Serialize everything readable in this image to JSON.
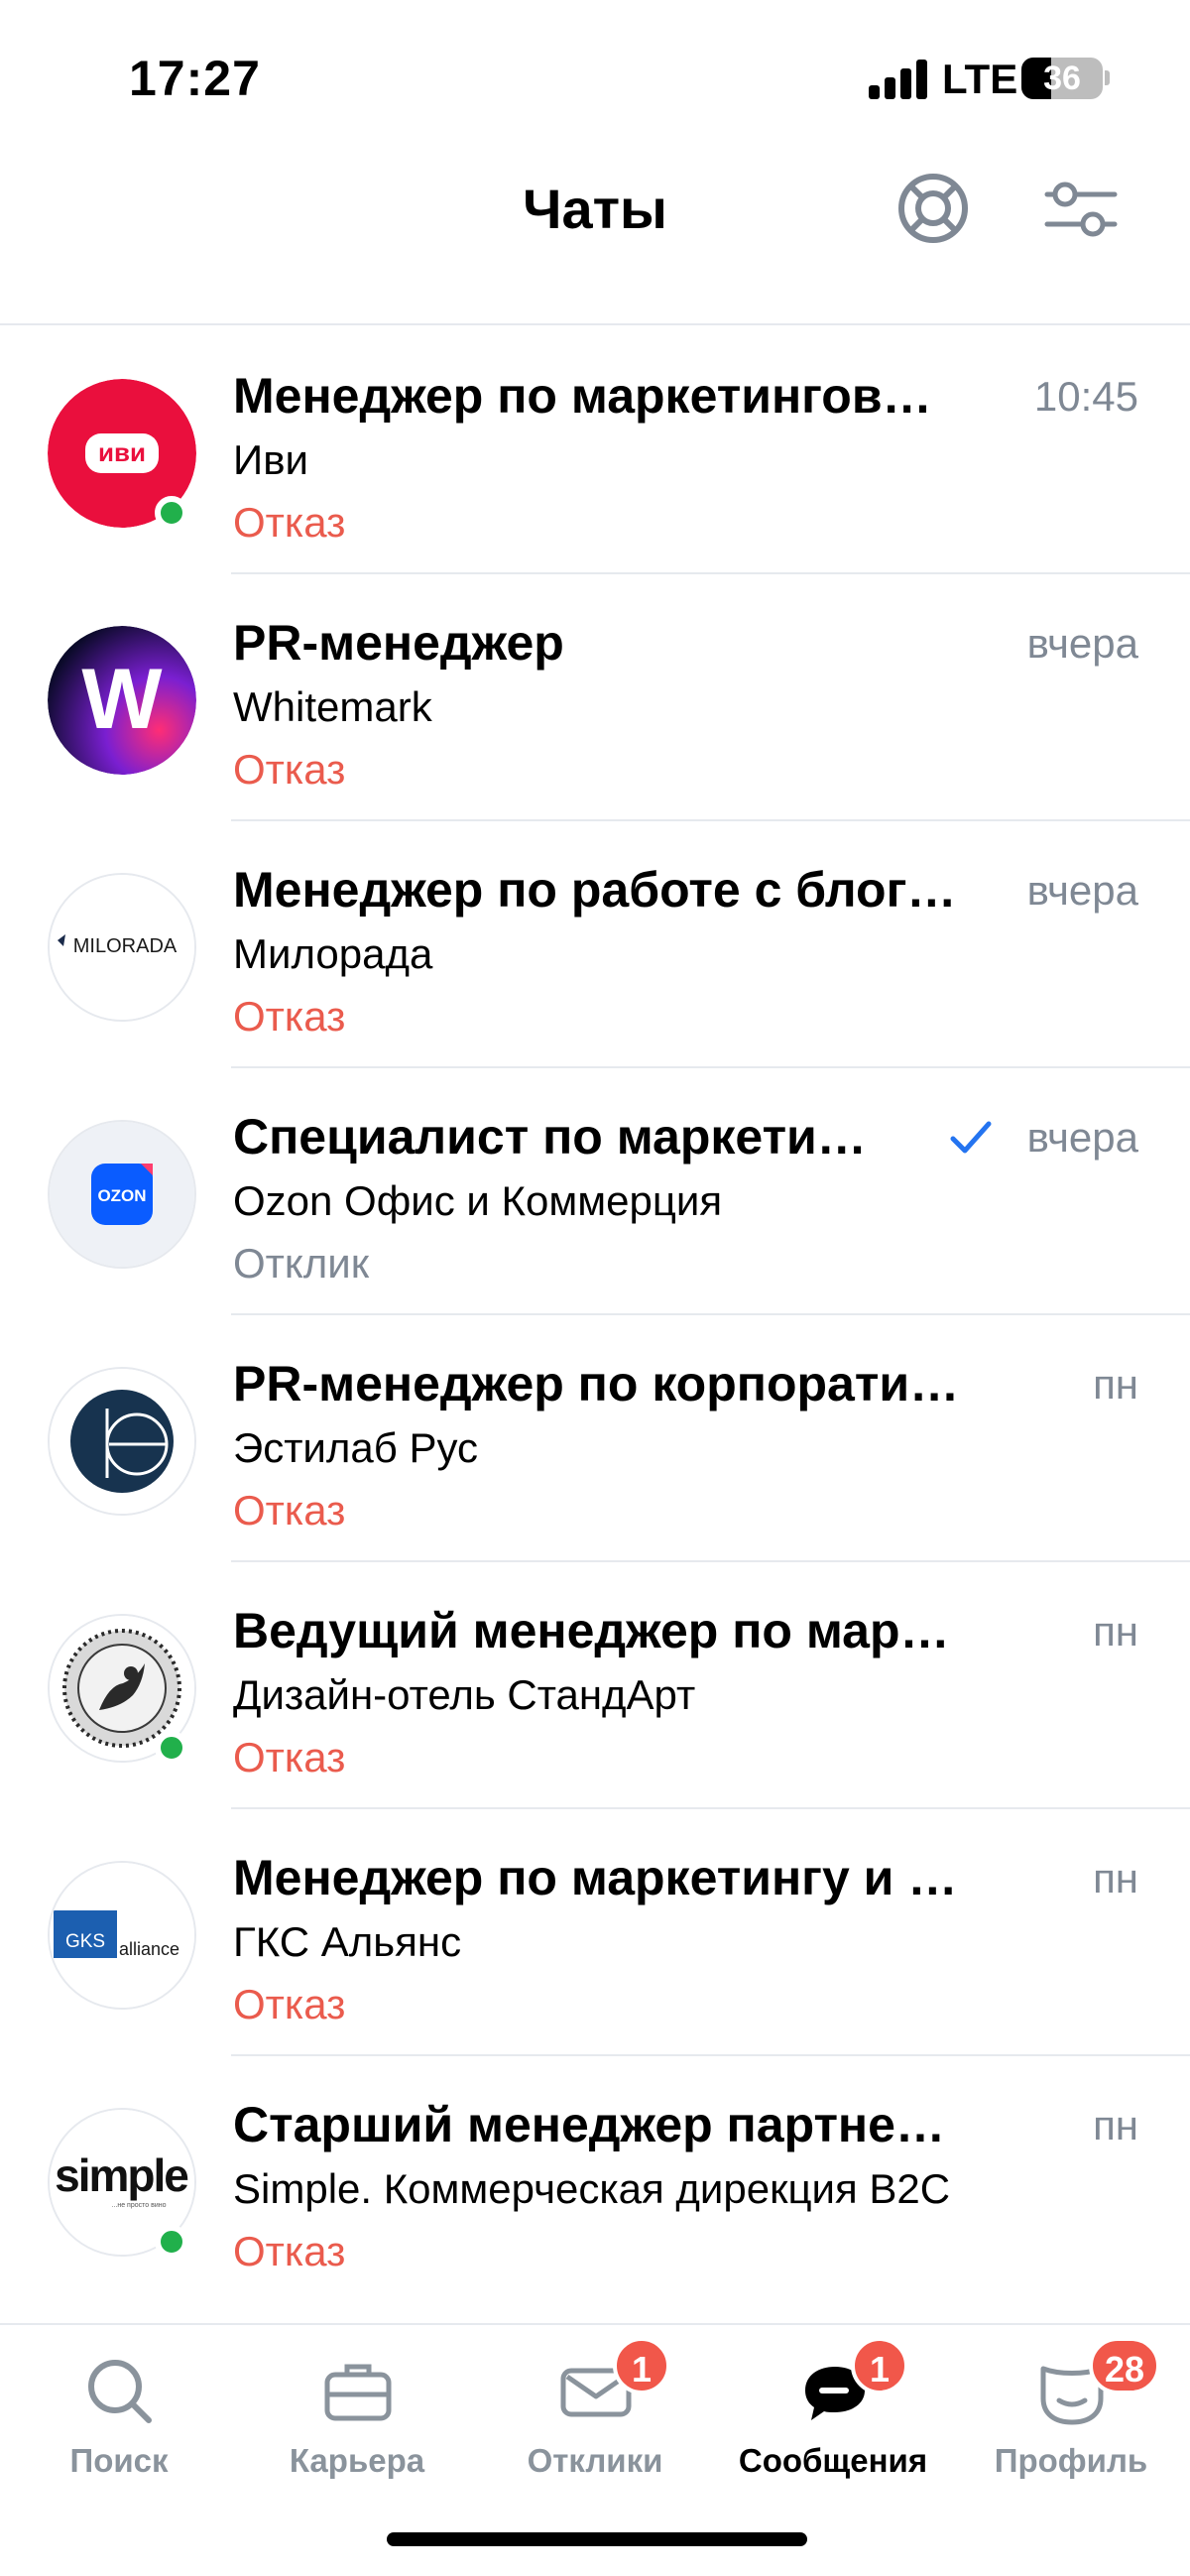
{
  "status_bar": {
    "time": "17:27",
    "network": "LTE",
    "battery": "36"
  },
  "header": {
    "title": "Чаты",
    "support_icon": "lifebuoy-icon",
    "filter_icon": "sliders-icon"
  },
  "colors": {
    "reject": "#ea5b4d",
    "muted": "#7f8894",
    "online": "#21b04b",
    "badge": "#f1574a",
    "ivi": "#ea0f3d",
    "gks": "#1c5fb0",
    "ozon": "#0a5cff"
  },
  "chats": [
    {
      "title": "Менеджер по маркетинговы...",
      "company": "Иви",
      "status": "Отказ",
      "time": "10:45",
      "logo_text": "иви",
      "online": true,
      "read": false
    },
    {
      "title": "PR-менеджер",
      "company": "Whitemark",
      "status": "Отказ",
      "time": "вчера",
      "logo_text": "W",
      "online": false,
      "read": false
    },
    {
      "title": "Менеджер по работе с блоге...",
      "company": "Милорада",
      "status": "Отказ",
      "time": "вчера",
      "logo_text": "MILORADA",
      "online": false,
      "read": false
    },
    {
      "title": "Специалист по маркетинг...",
      "company": "Ozon Офис и Коммерция",
      "status": "Отклик",
      "time": "вчера",
      "logo_text": "OZON",
      "online": false,
      "read": true
    },
    {
      "title": "PR-менеджер по корпоративны...",
      "company": "Эстилаб Рус",
      "status": "Отказ",
      "time": "пн",
      "logo_text": "",
      "online": false,
      "read": false
    },
    {
      "title": "Ведущий менеджер по маркети...",
      "company": "Дизайн-отель СтандАрт",
      "status": "Отказ",
      "time": "пн",
      "logo_text": "",
      "online": true,
      "read": false
    },
    {
      "title": "Менеджер по маркетингу и PR",
      "company": "ГКС Альянс",
      "status": "Отказ",
      "time": "пн",
      "logo_text": "GKS",
      "logo_text_2": "alliance",
      "online": false,
      "read": false
    },
    {
      "title": "Старший менеджер партнерско...",
      "company": "Simple. Коммерческая дирекция B2C",
      "status": "Отказ",
      "time": "пн",
      "logo_text": "simple",
      "logo_sub": "...не просто вино",
      "online": true,
      "read": false
    }
  ],
  "bottom_nav": [
    {
      "label": "Поиск",
      "icon": "search-icon",
      "badge": ""
    },
    {
      "label": "Карьера",
      "icon": "briefcase-icon",
      "badge": ""
    },
    {
      "label": "Отклики",
      "icon": "envelope-icon",
      "badge": "1"
    },
    {
      "label": "Сообщения",
      "icon": "chat-bubble-icon",
      "badge": "1",
      "active": true
    },
    {
      "label": "Профиль",
      "icon": "profile-icon",
      "badge": "28"
    }
  ]
}
